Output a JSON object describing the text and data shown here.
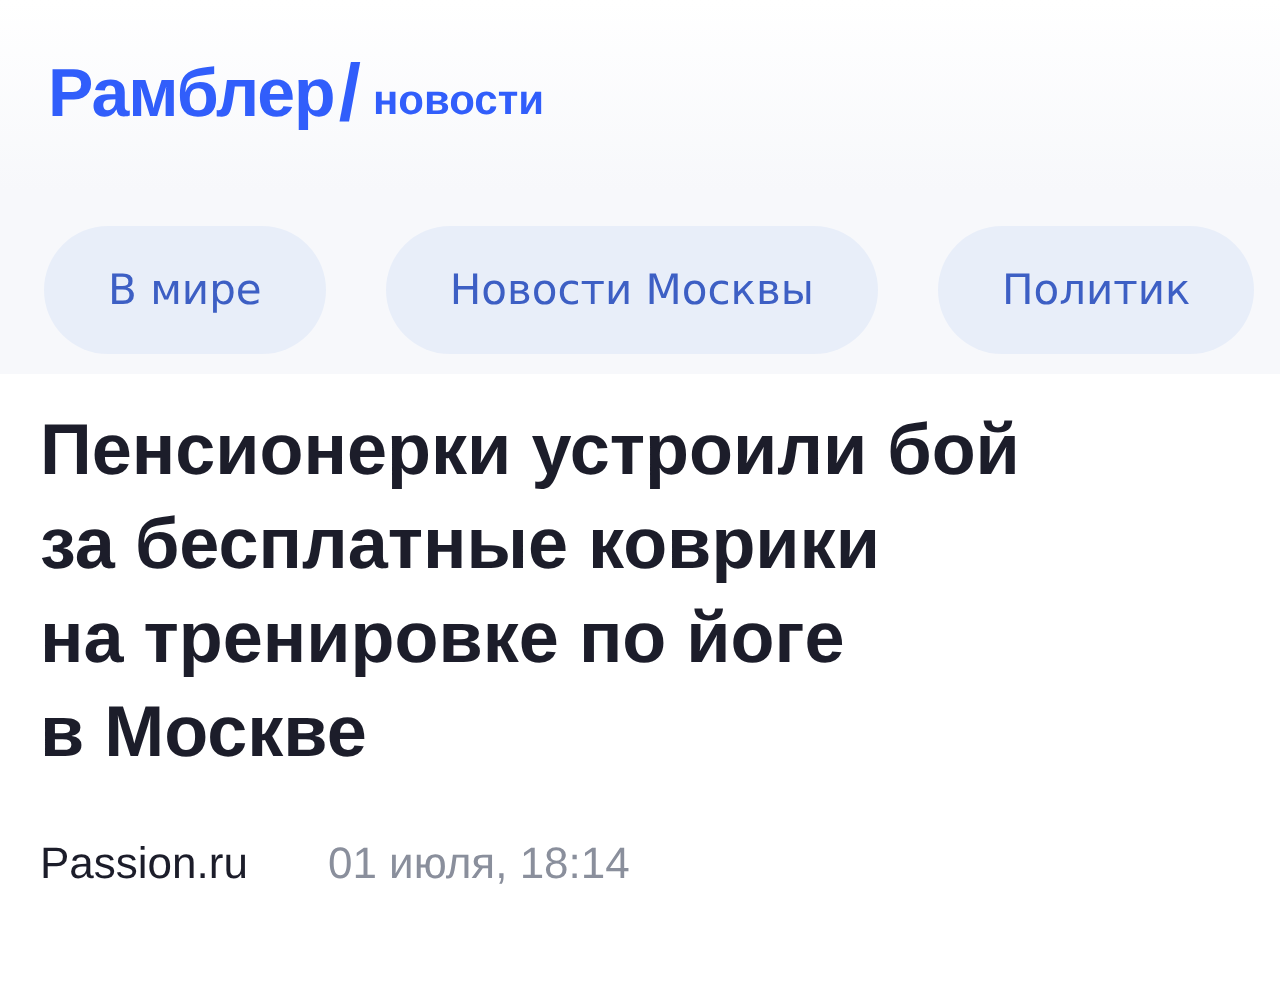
{
  "header": {
    "logo": "Рамблер",
    "slash": "/",
    "section": "новости"
  },
  "tabs": [
    {
      "label": "В мире",
      "selected": false
    },
    {
      "label": "Новости Москвы",
      "selected": false
    },
    {
      "label": "Политик",
      "selected": false
    }
  ],
  "article": {
    "title": "Пенсионерки устроили бой\nза бесплатные коврики\nна тренировке по йоге\nв Москве",
    "source": "Passion.ru",
    "date": "01 июля, 18:14"
  }
}
